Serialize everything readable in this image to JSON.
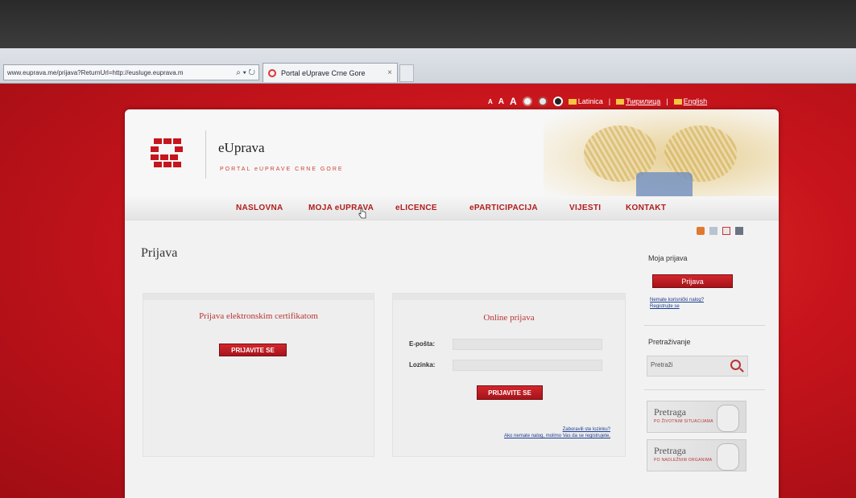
{
  "browser": {
    "url": "www.euprava.me/prijava?ReturnUrl=http://eusluge.euprava.m",
    "url_host": "www.euprava.me",
    "address_icons": "⌕ ▾ ↻",
    "tab_title": "Portal eUprave Crne Gore",
    "tab_close": "×"
  },
  "utility": {
    "font_small": "A",
    "font_medium": "A",
    "font_large": "A",
    "lang_latin": "Latinica",
    "lang_cyrillic": "Ћирилица",
    "lang_english": "English"
  },
  "header": {
    "brand": "eUprava",
    "tagline": "PORTAL eUPRAVE CRNE GORE"
  },
  "nav": {
    "items": [
      "NASLOVNA",
      "MOJA eUPRAVA",
      "eLICENCE",
      "ePARTICIPACIJA",
      "VIJESTI",
      "KONTAKT"
    ]
  },
  "main": {
    "title": "Prijava",
    "cert_box": {
      "title": "Prijava elektronskim certifikatom",
      "button": "PRIJAVITE SE"
    },
    "online_box": {
      "title": "Online prijava",
      "email_label": "E-pošta:",
      "password_label": "Lozinka:",
      "button": "PRIJAVITE SE",
      "forgot_link": "Zaboravili ste lozinku?",
      "register_link": "Ako nemate nalog, molimo Vas da se registrujete."
    }
  },
  "sidebar": {
    "my_login_title": "Moja prijava",
    "login_button": "Prijava",
    "register_link_1": "Nemate korisnički nalog?",
    "register_link_2": "Registrujte se",
    "search_title": "Pretraživanje",
    "search_placeholder": "Pretraži",
    "promo_1_title": "Pretraga",
    "promo_1_sub": "PO ŽIVOTNIM SITUACIJAMA",
    "promo_2_title": "Pretraga",
    "promo_2_sub": "PO NADLEŽNIM ORGANIMA"
  },
  "colors": {
    "accent_red": "#c4161c",
    "page_red": "#c8141c"
  }
}
